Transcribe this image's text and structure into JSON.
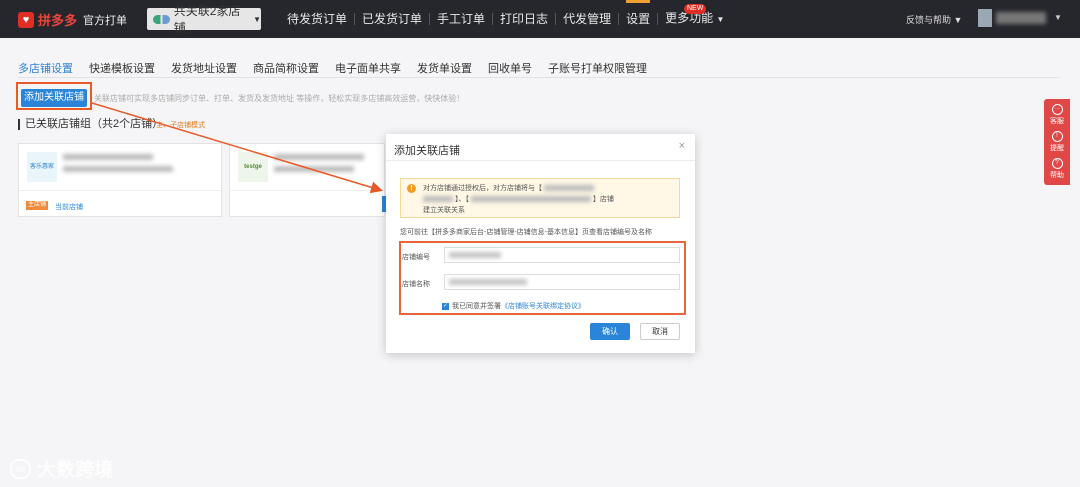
{
  "topbar": {
    "brand_name": "拼多多",
    "brand_sub": "官方打单",
    "shop_selector": "共关联2家店铺",
    "nav": [
      "待发货订单",
      "已发货订单",
      "手工订单",
      "打印日志",
      "代发管理",
      "设置",
      "更多功能"
    ],
    "new_badge": "NEW",
    "feedback": "反馈与帮助"
  },
  "tabs": [
    "多店铺设置",
    "快递模板设置",
    "发货地址设置",
    "商品简称设置",
    "电子面单共享",
    "发货单设置",
    "回收单号",
    "子账号打单权限管理"
  ],
  "main": {
    "add_button": "添加关联店铺",
    "hint": "关联店铺可实现多店铺同步订单、打单、发货及发货地址 等操作，轻松实现多店铺高效运营，快快体验！",
    "group_title": "已关联店铺组（共2个店铺）",
    "mode_tag": "主、子店铺模式",
    "card1_thumb": "客乐惠家",
    "card1_tag": "主店铺",
    "card1_current": "当前店铺",
    "card2_thumb": "testge"
  },
  "modal": {
    "title": "添加关联店铺",
    "close": "×",
    "warning_line1": "对方店铺通过授权后，对方店铺将与【",
    "warning_line2": "】、【",
    "warning_line2_end": "】店铺",
    "warning_line3": "建立关联关系",
    "note": "您可前往【拼多多商家后台-店铺管理-店铺信息-基本信息】页查看店铺编号及名称",
    "shop_id_label": "店铺编号",
    "shop_name_label": "店铺名称",
    "agree_text": "我已同意并签署",
    "agree_link": "《店铺账号关联绑定协议》",
    "ok": "确认",
    "cancel": "取消"
  },
  "float_bar": [
    "客服",
    "提醒",
    "帮助"
  ],
  "watermark": "大数跨境"
}
